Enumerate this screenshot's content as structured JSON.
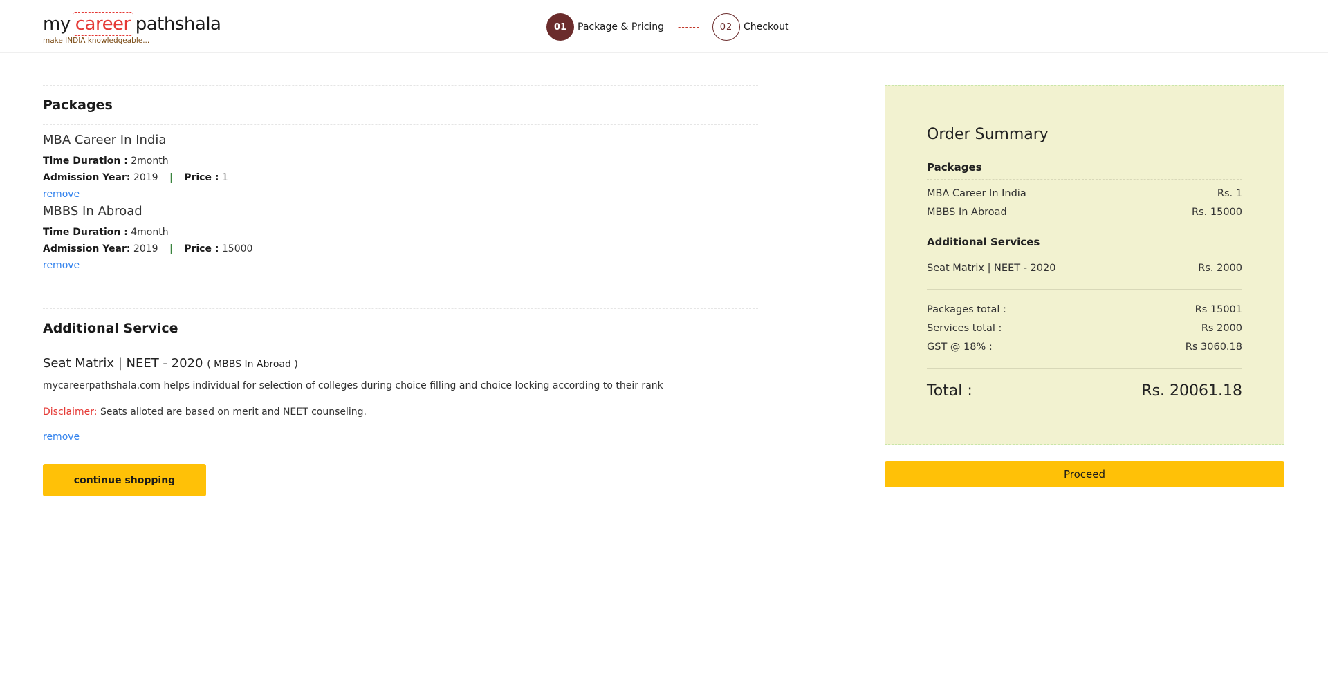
{
  "header": {
    "logo": {
      "part1": "my",
      "part2": "career",
      "part3": "pathshala",
      "tagline": "make INDIA knowledgeable..."
    },
    "steps": [
      {
        "number": "01",
        "label": "Package & Pricing"
      },
      {
        "separator": "------"
      },
      {
        "number": "02",
        "label": "Checkout"
      }
    ]
  },
  "packages_section": {
    "title": "Packages",
    "items": [
      {
        "name": "MBA Career In India",
        "duration_label": "Time Duration :",
        "duration": "2month",
        "year_label": "Admission Year:",
        "year": "2019",
        "pipe": "|",
        "price_label": "Price :",
        "price": "1",
        "remove": "remove"
      },
      {
        "name": "MBBS In Abroad",
        "duration_label": "Time Duration :",
        "duration": "4month",
        "year_label": "Admission Year:",
        "year": "2019",
        "pipe": "|",
        "price_label": "Price :",
        "price": "15000",
        "remove": "remove"
      }
    ]
  },
  "services_section": {
    "title": "Additional Service",
    "item": {
      "name": "Seat Matrix | NEET - 2020",
      "sub": "( MBBS In Abroad )",
      "description": "mycareerpathshala.com helps individual for selection of colleges during choice filling and choice locking according to their rank",
      "disclaimer_label": "Disclaimer:",
      "disclaimer_text": " Seats alloted are based on merit and NEET counseling.",
      "remove": "remove"
    },
    "continue_label": "continue shopping"
  },
  "summary": {
    "title": "Order Summary",
    "packages_head": "Packages",
    "packages": [
      {
        "name": "MBA Career In India",
        "price": "Rs. 1"
      },
      {
        "name": "MBBS In Abroad",
        "price": "Rs. 15000"
      }
    ],
    "services_head": "Additional Services",
    "services": [
      {
        "name": "Seat Matrix | NEET - 2020",
        "price": "Rs. 2000"
      }
    ],
    "totals": [
      {
        "label": "Packages total :",
        "value": "Rs 15001"
      },
      {
        "label": "Services total :",
        "value": "Rs 2000"
      },
      {
        "label": "GST @ 18% :",
        "value": "Rs 3060.18"
      }
    ],
    "total_label": "Total :",
    "total_value": "Rs. 20061.18",
    "proceed_label": "Proceed"
  }
}
